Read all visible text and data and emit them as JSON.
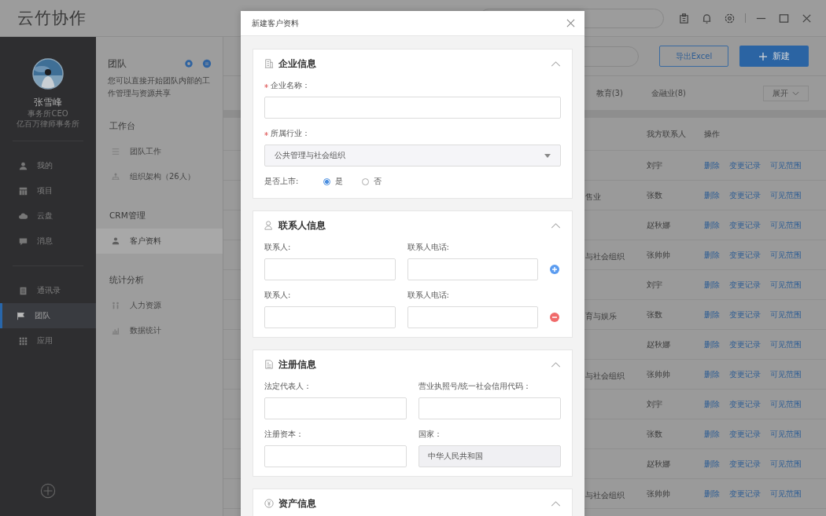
{
  "app": {
    "logo": "云竹协作"
  },
  "user": {
    "name": "张雪峰",
    "role": "事务所CEO",
    "company": "亿百万律师事务所"
  },
  "nav_groups": [
    [
      {
        "label": "我的",
        "selected": false
      },
      {
        "label": "项目",
        "selected": false
      },
      {
        "label": "云盘",
        "selected": false
      },
      {
        "label": "消息",
        "selected": false
      }
    ],
    [
      {
        "label": "通讯录",
        "selected": false
      },
      {
        "label": "团队",
        "selected": true
      },
      {
        "label": "应用",
        "selected": false
      }
    ]
  ],
  "team_panel": {
    "title": "团队",
    "description": "您可以直接开始团队内部的工作管理与资源共享",
    "sections": [
      {
        "title": "工作台",
        "items": [
          {
            "label": "团队工作",
            "selected": false
          },
          {
            "label": "组织架构（26人）",
            "selected": false
          }
        ]
      },
      {
        "title": "CRM管理",
        "items": [
          {
            "label": "客户资料",
            "selected": true
          }
        ]
      },
      {
        "title": "统计分析",
        "items": [
          {
            "label": "人力资源",
            "selected": false
          },
          {
            "label": "数据统计",
            "selected": false
          }
        ]
      }
    ]
  },
  "toolbar": {
    "export_button": "导出Excel",
    "new_button": "新建"
  },
  "filters": [
    {
      "label": "教育(3)"
    },
    {
      "label": "金融业(8)"
    }
  ],
  "expand_button": "展开",
  "table": {
    "columns": [
      "我方联系人",
      "操作"
    ],
    "rows": [
      {
        "contact": "刘宇",
        "actions": [
          "删除",
          "变更记录",
          "可见范围"
        ]
      },
      {
        "column_1": "售业",
        "contact": "张数",
        "actions": [
          "删除",
          "变更记录",
          "可见范围"
        ]
      },
      {
        "contact": "赵秋娜",
        "actions": [
          "删除",
          "变更记录",
          "可见范围"
        ]
      },
      {
        "column_1": "与社会组织",
        "contact": "张帅帅",
        "actions": [
          "删除",
          "变更记录",
          "可见范围"
        ]
      },
      {
        "contact": "刘宇",
        "actions": [
          "删除",
          "变更记录",
          "可见范围"
        ]
      },
      {
        "column_1": "育与娱乐",
        "contact": "张数",
        "actions": [
          "删除",
          "变更记录",
          "可见范围"
        ]
      },
      {
        "contact": "赵秋娜",
        "actions": [
          "删除",
          "变更记录",
          "可见范围"
        ]
      },
      {
        "column_1": "与社会组织",
        "contact": "张帅帅",
        "actions": [
          "删除",
          "变更记录",
          "可见范围"
        ]
      },
      {
        "contact": "刘宇",
        "actions": [
          "删除",
          "变更记录",
          "可见范围"
        ]
      },
      {
        "contact": "张数",
        "actions": [
          "删除",
          "变更记录",
          "可见范围"
        ]
      },
      {
        "contact": "赵秋娜",
        "actions": [
          "删除",
          "变更记录",
          "可见范围"
        ]
      },
      {
        "column_1": "与社会组织",
        "contact": "张帅帅",
        "actions": [
          "删除",
          "变更记录",
          "可见范围"
        ]
      }
    ]
  },
  "dialog": {
    "title": "新建客户资料",
    "sections": [
      {
        "title": "企业信息",
        "expanded": true,
        "rows": [
          {
            "fields": [
              {
                "kind": "text",
                "label": "企业名称：",
                "required": true
              }
            ]
          },
          {
            "fields": [
              {
                "kind": "select",
                "label": "所属行业：",
                "required": true,
                "value": "公共管理与社会组织"
              }
            ]
          },
          {
            "fields": [
              {
                "kind": "radio",
                "label": "是否上市:",
                "options": [
                  {
                    "label": "是",
                    "selected": true
                  },
                  {
                    "label": "否",
                    "selected": false
                  }
                ]
              }
            ]
          }
        ]
      },
      {
        "title": "联系人信息",
        "expanded": true,
        "rows": [
          {
            "fields": [
              {
                "kind": "text",
                "label": "联系人:"
              },
              {
                "kind": "text",
                "label": "联系人电话:"
              }
            ],
            "removable": false
          },
          {
            "fields": [
              {
                "kind": "text",
                "label": "联系人:"
              },
              {
                "kind": "text",
                "label": "联系人电话:"
              }
            ],
            "removable": true
          }
        ]
      },
      {
        "title": "注册信息",
        "expanded": true,
        "rows": [
          {
            "fields": [
              {
                "kind": "text",
                "label": "法定代表人："
              },
              {
                "kind": "text",
                "label": "营业执照号/统一社会信用代码："
              }
            ]
          },
          {
            "fields": [
              {
                "kind": "text",
                "label": "注册资本："
              },
              {
                "kind": "text",
                "label": "国家：",
                "value": "中华人民共和国",
                "disabled": true
              }
            ]
          }
        ]
      },
      {
        "title": "资产信息",
        "expanded": true
      }
    ]
  }
}
